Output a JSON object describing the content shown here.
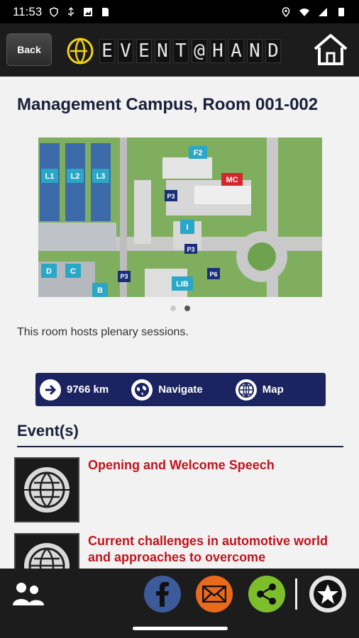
{
  "status": {
    "time": "11:53"
  },
  "header": {
    "back_label": "Back",
    "logo_text": "EVENT@HAND",
    "home_icon": "home-icon"
  },
  "room": {
    "title": "Management Campus, Room 001-002",
    "description": "This room hosts plenary sessions."
  },
  "map": {
    "labels": [
      "F2",
      "MC",
      "L1",
      "L2",
      "L3",
      "P3",
      "I",
      "P3",
      "D",
      "C",
      "B",
      "P3",
      "LIB",
      "P6"
    ],
    "highlight_color": "#d6262d",
    "label_color": "#2aa7c7"
  },
  "carousel": {
    "active_index": 1,
    "count": 2
  },
  "actions": {
    "distance": "9766 km",
    "navigate": "Navigate",
    "map": "Map"
  },
  "events": {
    "heading": "Event(s)",
    "items": [
      {
        "title": "Opening and Welcome Speech"
      },
      {
        "title": "Current challenges in automotive world and approaches to overcome"
      }
    ]
  },
  "bottom": {
    "icons": [
      "people-icon",
      "facebook-icon",
      "email-icon",
      "share-icon",
      "star-icon"
    ]
  },
  "colors": {
    "accent": "#1b2460",
    "event_title": "#c0141d",
    "header": "#1c1c1c"
  }
}
